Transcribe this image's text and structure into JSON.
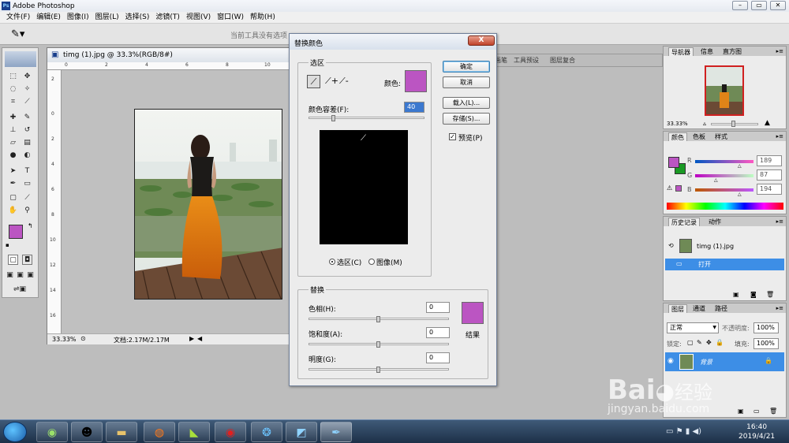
{
  "app": {
    "title": "Adobe Photoshop"
  },
  "window_controls": {
    "minimize": "–",
    "restore": "▭",
    "close": "✕"
  },
  "menu": [
    "文件(F)",
    "编辑(E)",
    "图像(I)",
    "图层(L)",
    "选择(S)",
    "滤镜(T)",
    "视图(V)",
    "窗口(W)",
    "帮助(H)"
  ],
  "options_bar": {
    "hint": "当前工具没有选项",
    "well_tabs": [
      "画笔",
      "工具预设",
      "图层复合"
    ]
  },
  "toolbox": {
    "fg_color": "#bb55c2",
    "bg_color": "#1a9a24"
  },
  "document": {
    "title": "timg (1).jpg @ 33.3%(RGB/8#)",
    "zoom": "33.33%",
    "doc_info": "文档:2.17M/2.17M",
    "ruler_top": [
      "0",
      "2",
      "4",
      "6",
      "8",
      "10"
    ],
    "ruler_left": [
      "2",
      "0",
      "2",
      "4",
      "6",
      "8",
      "10",
      "12",
      "14",
      "16"
    ]
  },
  "dialog": {
    "title": "替换颜色",
    "close_label": "X",
    "selection_group": "选区",
    "color_label": "颜色:",
    "picked_color": "#bb55c2",
    "tolerance_label": "颜色容差(F):",
    "tolerance_value": "40",
    "tolerance_level": 0.2,
    "radio_selection": "选区(C)",
    "radio_image": "图像(M)",
    "replace_group": "替换",
    "hue_label": "色相(H):",
    "hue_value": "0",
    "saturation_label": "饱和度(A):",
    "saturation_value": "0",
    "lightness_label": "明度(G):",
    "lightness_value": "0",
    "result_label": "结果",
    "result_color": "#bb55c2",
    "buttons": {
      "ok": "确定",
      "cancel": "取消",
      "load": "载入(L)...",
      "save": "存储(S)..."
    },
    "preview_label": "预览(P)",
    "preview_checked": true
  },
  "navigator": {
    "tabs": [
      "导航器",
      "信息",
      "直方图"
    ],
    "zoom": "33.33%"
  },
  "color_panel": {
    "tabs": [
      "颜色",
      "色板",
      "样式"
    ],
    "r_label": "R",
    "r_value": "189",
    "g_label": "G",
    "g_value": "87",
    "b_label": "B",
    "b_value": "194"
  },
  "history_panel": {
    "tabs": [
      "历史记录",
      "动作"
    ],
    "snapshot": "timg (1).jpg",
    "step": "打开"
  },
  "layers_panel": {
    "tabs": [
      "图层",
      "通道",
      "路径"
    ],
    "blend_mode": "正常",
    "opacity_label": "不透明度:",
    "opacity": "100%",
    "lock_label": "锁定:",
    "fill_label": "填充:",
    "fill": "100%",
    "layer_name": "背景"
  },
  "taskbar": {
    "time": "16:40",
    "date": "2019/4/21"
  },
  "watermark": {
    "brand": "Bai",
    "brand2": "经验",
    "url": "jingyan.baidu.com"
  }
}
